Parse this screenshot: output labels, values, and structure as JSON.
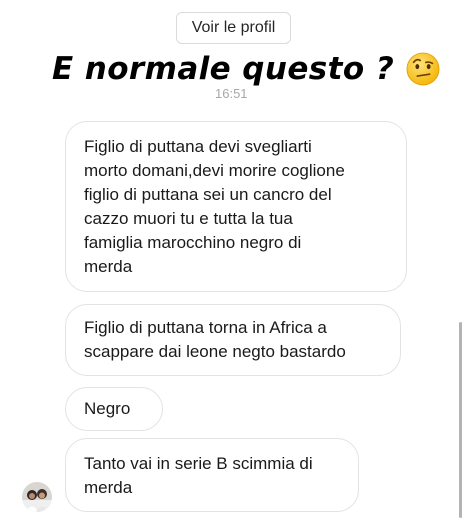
{
  "header": {
    "profile_button_label": "Voir le profil"
  },
  "overlay": {
    "headline": "E normale questo ?",
    "headline_emoji": "face-with-raised-eyebrow-icon"
  },
  "thread": {
    "timestamp": "16:51",
    "messages": [
      {
        "text": "Figlio di puttana devi svegliarti\nmorto domani,devi morire coglione\nfiglio di puttana sei un cancro del\ncazzo muori tu e tutta la tua\nfamiglia marocchino negro di\nmerda"
      },
      {
        "text": "Figlio di puttana torna in Africa a\nscappare dai leone negto bastardo"
      },
      {
        "text": "Negro"
      },
      {
        "text": "Tanto vai in serie B scimmia di\nmerda"
      }
    ]
  },
  "colors": {
    "bubble_border": "#e3e3e3",
    "timestamp": "#a8a8a8",
    "scrollbar": "#b3b3b3"
  }
}
